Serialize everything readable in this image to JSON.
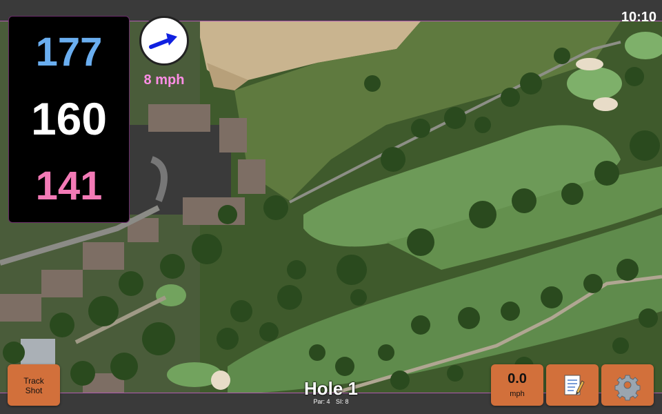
{
  "status": {
    "time": "10:10"
  },
  "distances": {
    "back": "177",
    "middle": "160",
    "front": "141"
  },
  "wind": {
    "speed_label": "8 mph",
    "direction_icon": "arrow-icon"
  },
  "hole": {
    "title": "Hole 1",
    "par": "Par: 4",
    "si": "SI: 8"
  },
  "buttons": {
    "track_shot": [
      "Track",
      "Shot"
    ],
    "wind_value": "0.0",
    "wind_unit": "mph",
    "notes_icon": "notepad-icon",
    "settings_icon": "gear-icon"
  },
  "colors": {
    "back": "#6aaef0",
    "middle": "#ffffff",
    "front": "#f37ab6",
    "button": "#d2703b",
    "wind_text": "#ff8ee6"
  }
}
